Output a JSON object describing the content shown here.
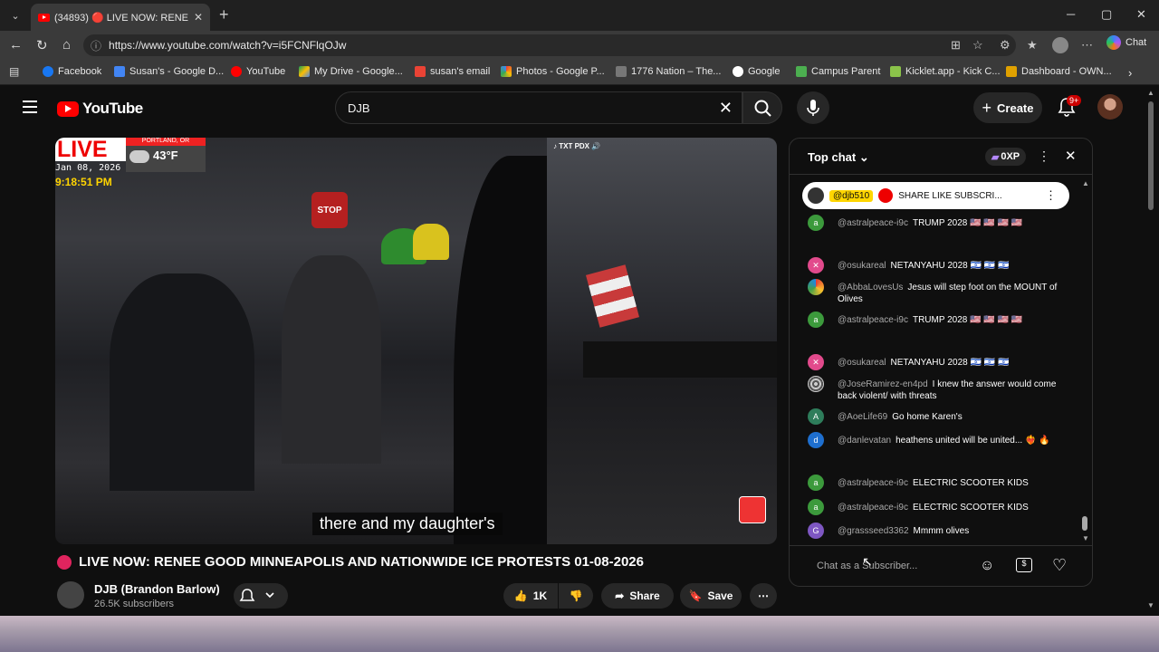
{
  "browser": {
    "tab_title": "(34893) 🔴 LIVE NOW: RENE",
    "url": "https://www.youtube.com/watch?v=i5FCNFlqOJw",
    "copilot_label": "Chat",
    "bookmarks": [
      "Facebook",
      "Susan's - Google D...",
      "YouTube",
      "My Drive - Google...",
      "susan's email",
      "Photos - Google P...",
      "1776 Nation – The...",
      "Google",
      "Campus Parent",
      "Kicklet.app - Kick C...",
      "Dashboard - OWN..."
    ]
  },
  "youtube": {
    "logo_text": "YouTube",
    "search_value": "DJB",
    "create_label": "Create",
    "notif_badge": "9+"
  },
  "video": {
    "live_badge": "LIVE",
    "weather_city": "PORTLAND, OR",
    "temperature": "43°F",
    "date": "Jan 08, 2026",
    "time": "9:18:51 PM",
    "overlay_tag": "TXT PDX",
    "caption": "there and my daughter's",
    "title": "LIVE NOW: RENEE GOOD MINNEAPOLIS AND NATIONWIDE ICE PROTESTS 01-08-2026",
    "channel": "DJB (Brandon Barlow)",
    "subscribers": "26.5K subscribers",
    "likes": "1K",
    "share_label": "Share",
    "save_label": "Save"
  },
  "chat": {
    "mode": "Top chat",
    "points": "0XP",
    "pinned_user": "@djb510",
    "pinned_text": "SHARE LIKE SUBSCRI...",
    "placeholder": "Chat as a Subscriber...",
    "messages": [
      {
        "user": "@astralpeace-i9c",
        "text": "TRUMP 2028 🇺🇸 🇺🇸 🇺🇸 🇺🇸",
        "avatar": "a",
        "color": "#3c9a3c"
      },
      {
        "user": "@osukareal",
        "text": "NETANYAHU 2028 🇮🇱 🇮🇱 🇮🇱",
        "avatar": "✕",
        "color": "#e24a8c"
      },
      {
        "user": "@AbbaLovesUs",
        "text": "Jesus will step foot on the MOUNT of Olives",
        "avatar": "",
        "color": "#b58a3c"
      },
      {
        "user": "@astralpeace-i9c",
        "text": "TRUMP 2028 🇺🇸 🇺🇸 🇺🇸 🇺🇸",
        "avatar": "a",
        "color": "#3c9a3c"
      },
      {
        "user": "@osukareal",
        "text": "NETANYAHU 2028 🇮🇱 🇮🇱 🇮🇱",
        "avatar": "✕",
        "color": "#e24a8c"
      },
      {
        "user": "@JoseRamirez-en4pd",
        "text": "I knew the answer would come back violent/ with threats",
        "avatar": "",
        "color": "#888"
      },
      {
        "user": "@AoeLife69",
        "text": "Go home Karen's",
        "avatar": "A",
        "color": "#2e7d5b"
      },
      {
        "user": "@danlevatan",
        "text": "heathens united will be united... ❤️‍🔥 🔥",
        "avatar": "d",
        "color": "#1e6fcf"
      },
      {
        "user": "@astralpeace-i9c",
        "text": "ELECTRIC SCOOTER KIDS",
        "avatar": "a",
        "color": "#3c9a3c"
      },
      {
        "user": "@astralpeace-i9c",
        "text": "ELECTRIC SCOOTER KIDS",
        "avatar": "a",
        "color": "#3c9a3c"
      },
      {
        "user": "@grassseed3362",
        "text": "Mmmm olives",
        "avatar": "G",
        "color": "#7e57c2"
      }
    ]
  }
}
